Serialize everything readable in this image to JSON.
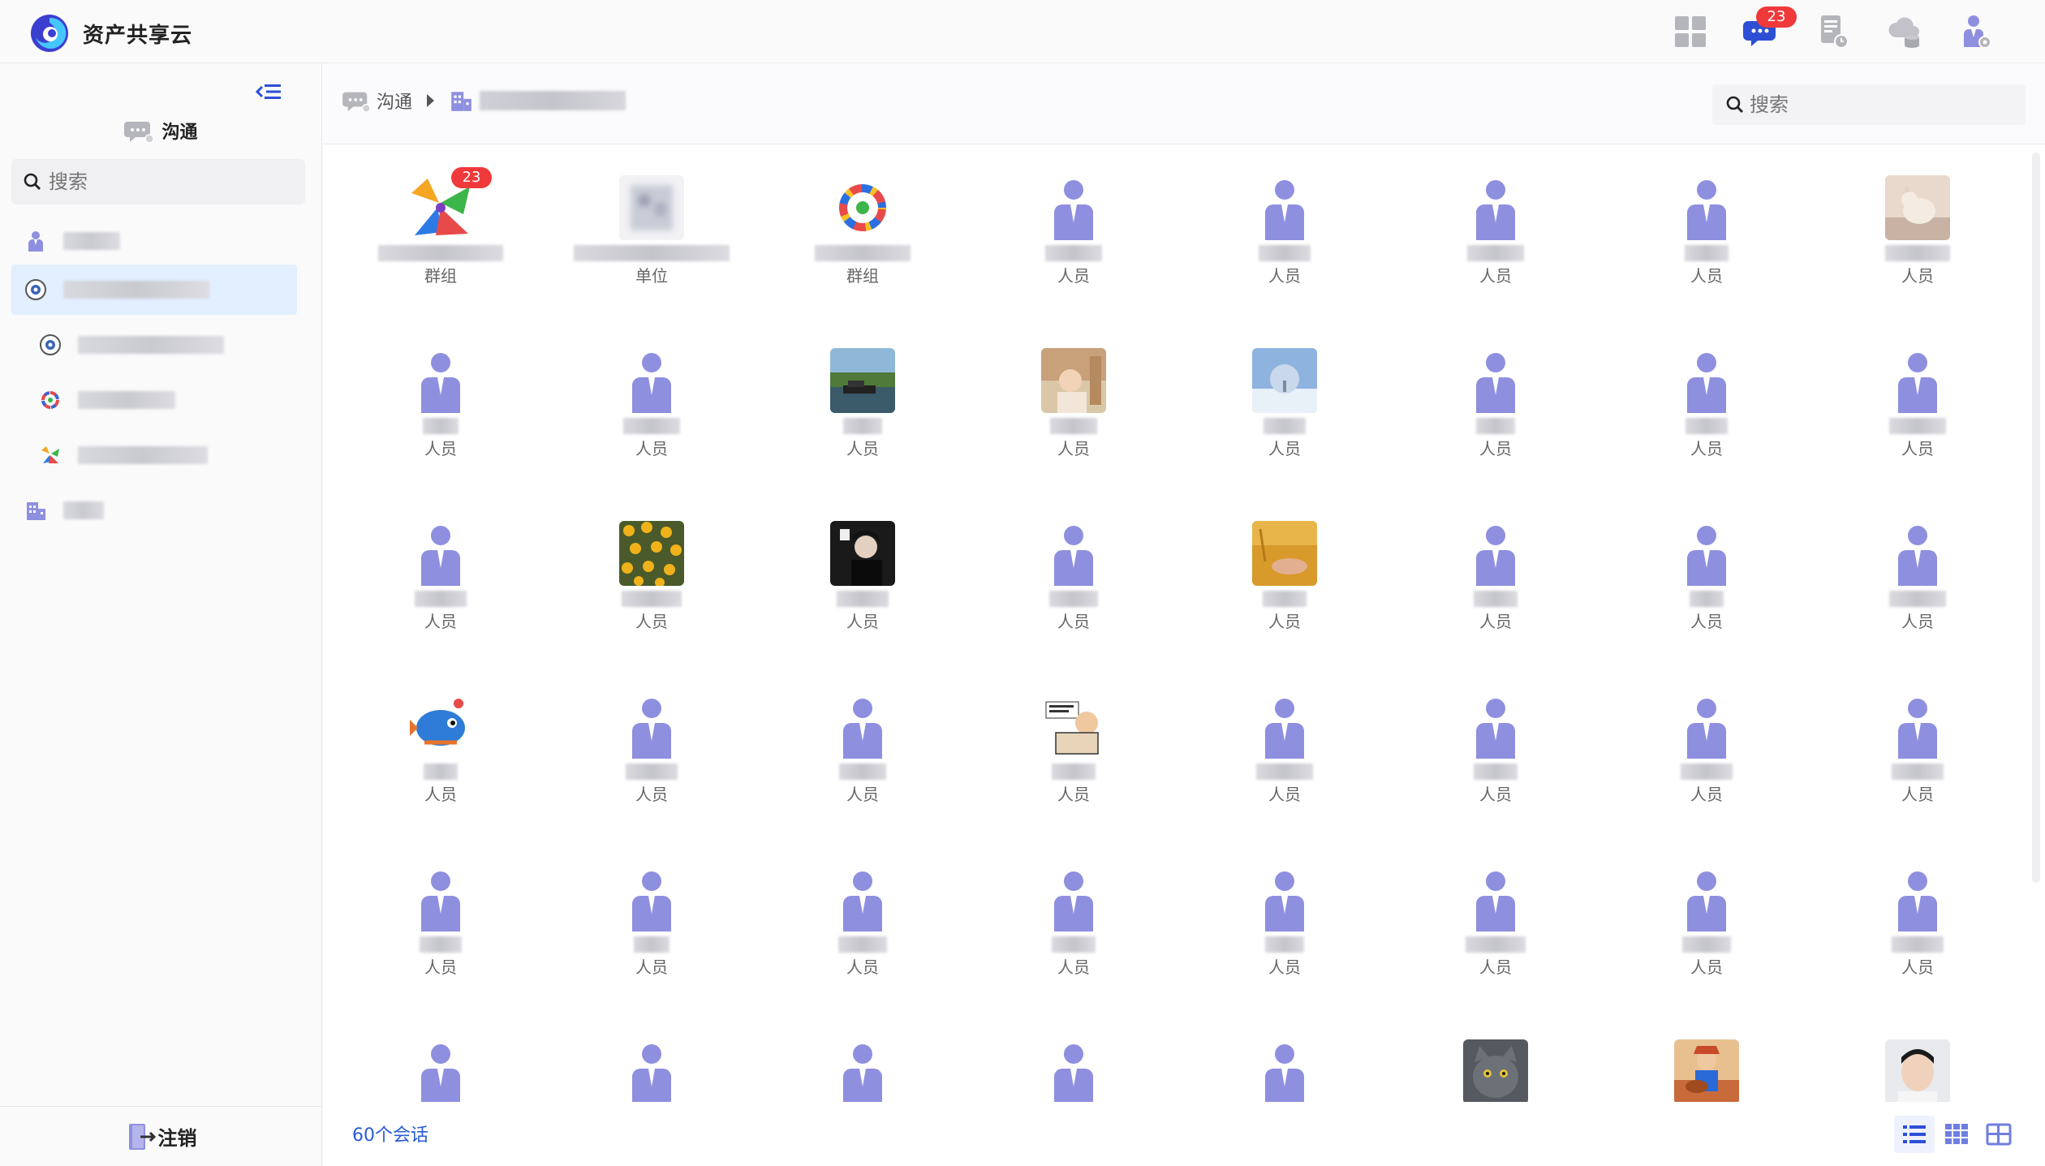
{
  "app": {
    "name": "资产共享云"
  },
  "topbar": {
    "icons": [
      {
        "name": "apps-grid-icon",
        "badge": ""
      },
      {
        "name": "chat-icon",
        "badge": "23"
      },
      {
        "name": "document-clock-icon",
        "badge": ""
      },
      {
        "name": "cloud-database-icon",
        "badge": ""
      },
      {
        "name": "user-settings-icon",
        "badge": ""
      }
    ]
  },
  "sidebar": {
    "title": "沟通",
    "search_placeholder": "搜索",
    "logout_label": "注销"
  },
  "breadcrumb": {
    "root_label": "沟通"
  },
  "main": {
    "search_placeholder": "搜索",
    "count_label": "60个会话"
  },
  "colors": {
    "accent": "#2b5bd7",
    "person_icon": "#8f8fe0",
    "badge": "#f0393a",
    "active_item": "#e2efff"
  },
  "contacts": [
    {
      "type": "群组",
      "avatar": "colorful-people-logo",
      "badge": "23"
    },
    {
      "type": "单位",
      "avatar": "blurred-grey"
    },
    {
      "type": "群组",
      "avatar": "circle-people-logo"
    },
    {
      "type": "人员",
      "avatar": "person-icon"
    },
    {
      "type": "人员",
      "avatar": "person-icon"
    },
    {
      "type": "人员",
      "avatar": "person-icon"
    },
    {
      "type": "人员",
      "avatar": "person-icon"
    },
    {
      "type": "人员",
      "avatar": "photo-dog"
    },
    {
      "type": "人员",
      "avatar": "person-icon"
    },
    {
      "type": "人员",
      "avatar": "person-icon"
    },
    {
      "type": "人员",
      "avatar": "photo-lake"
    },
    {
      "type": "人员",
      "avatar": "photo-child"
    },
    {
      "type": "人员",
      "avatar": "photo-snow-tree"
    },
    {
      "type": "人员",
      "avatar": "person-icon"
    },
    {
      "type": "人员",
      "avatar": "person-icon"
    },
    {
      "type": "人员",
      "avatar": "person-icon"
    },
    {
      "type": "人员",
      "avatar": "person-icon"
    },
    {
      "type": "人员",
      "avatar": "photo-flowers"
    },
    {
      "type": "人员",
      "avatar": "photo-man-dark"
    },
    {
      "type": "人员",
      "avatar": "person-icon"
    },
    {
      "type": "人员",
      "avatar": "photo-wheat"
    },
    {
      "type": "人员",
      "avatar": "person-icon"
    },
    {
      "type": "人员",
      "avatar": "person-icon"
    },
    {
      "type": "人员",
      "avatar": "person-icon"
    },
    {
      "type": "人员",
      "avatar": "photo-fish-cartoon"
    },
    {
      "type": "人员",
      "avatar": "person-icon"
    },
    {
      "type": "人员",
      "avatar": "person-icon"
    },
    {
      "type": "人员",
      "avatar": "photo-sticker"
    },
    {
      "type": "人员",
      "avatar": "person-icon"
    },
    {
      "type": "人员",
      "avatar": "person-icon"
    },
    {
      "type": "人员",
      "avatar": "person-icon"
    },
    {
      "type": "人员",
      "avatar": "person-icon"
    },
    {
      "type": "人员",
      "avatar": "person-icon"
    },
    {
      "type": "人员",
      "avatar": "person-icon"
    },
    {
      "type": "人员",
      "avatar": "person-icon"
    },
    {
      "type": "人员",
      "avatar": "person-icon"
    },
    {
      "type": "人员",
      "avatar": "person-icon"
    },
    {
      "type": "人员",
      "avatar": "person-icon"
    },
    {
      "type": "人员",
      "avatar": "person-icon"
    },
    {
      "type": "人员",
      "avatar": "person-icon"
    },
    {
      "type": "",
      "avatar": "person-icon"
    },
    {
      "type": "",
      "avatar": "person-icon"
    },
    {
      "type": "",
      "avatar": "person-icon"
    },
    {
      "type": "",
      "avatar": "person-icon"
    },
    {
      "type": "",
      "avatar": "person-icon"
    },
    {
      "type": "",
      "avatar": "photo-cat"
    },
    {
      "type": "",
      "avatar": "photo-boy-guitar"
    },
    {
      "type": "",
      "avatar": "photo-man-face"
    }
  ]
}
